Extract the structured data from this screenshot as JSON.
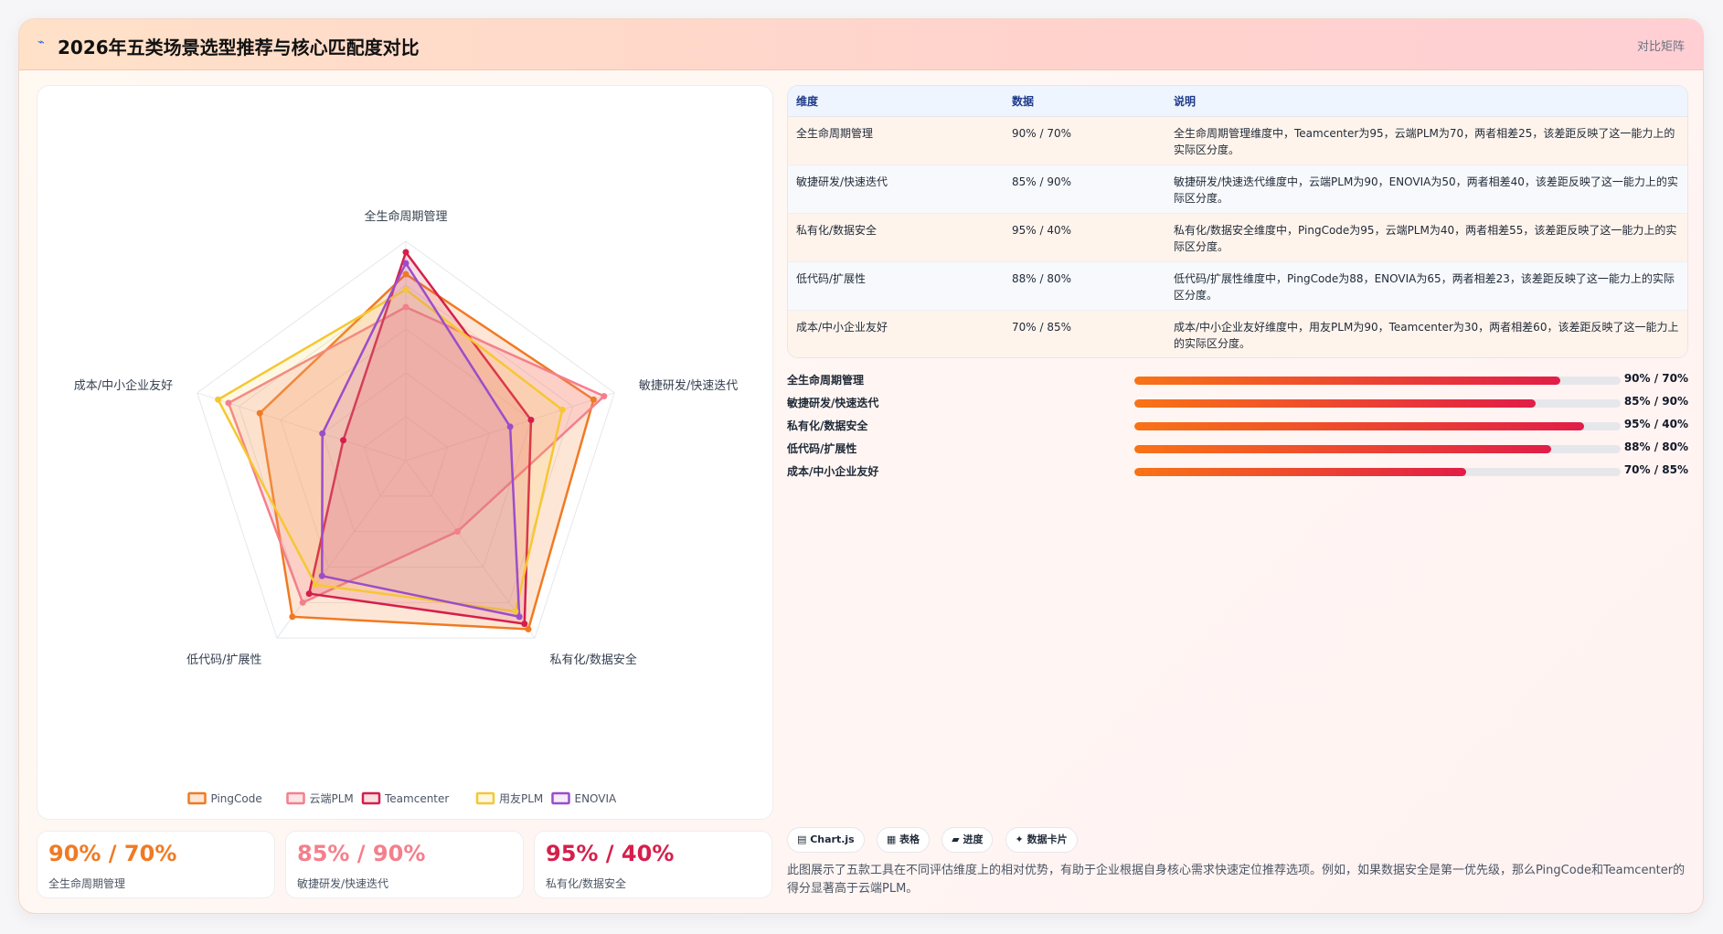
{
  "header": {
    "icon": "chart-icon",
    "title": "2026年五类场景选型推荐与核心匹配度对比",
    "tag": "对比矩阵"
  },
  "chart_data": {
    "type": "radar",
    "axes": [
      "全生命周期管理",
      "敏捷研发/快速迭代",
      "私有化/数据安全",
      "低代码/扩展性",
      "成本/中小企业友好"
    ],
    "rmax": 100,
    "rings": 5,
    "series": [
      {
        "name": "PingCode",
        "color": "#f07a23",
        "fill": "rgba(249,140,70,0.22)",
        "values": [
          85,
          90,
          95,
          88,
          70
        ]
      },
      {
        "name": "云端PLM",
        "color": "#f47f8c",
        "fill": "rgba(247,130,140,0.22)",
        "values": [
          70,
          95,
          40,
          80,
          85
        ]
      },
      {
        "name": "Teamcenter",
        "color": "#d51f4b",
        "fill": "rgba(220,70,90,0.18)",
        "values": [
          95,
          60,
          92,
          75,
          30
        ]
      },
      {
        "name": "用友PLM",
        "color": "#f5c733",
        "fill": "rgba(250,210,70,0.15)",
        "values": [
          78,
          75,
          85,
          70,
          90
        ]
      },
      {
        "name": "ENOVIA",
        "color": "#9b4dca",
        "fill": "rgba(170,100,210,0.12)",
        "values": [
          90,
          50,
          88,
          65,
          40
        ]
      }
    ]
  },
  "kpis": [
    {
      "value": "90% / 70%",
      "label": "全生命周期管理",
      "color": "#f07a23"
    },
    {
      "value": "85% / 90%",
      "label": "敏捷研发/快速迭代",
      "color": "#f47f8c"
    },
    {
      "value": "95% / 40%",
      "label": "私有化/数据安全",
      "color": "#d51f4b"
    }
  ],
  "table": {
    "headers": [
      "维度",
      "数据",
      "说明"
    ],
    "rows": [
      [
        "全生命周期管理",
        "90% / 70%",
        "全生命周期管理维度中，Teamcenter为95，云端PLM为70，两者相差25，该差距反映了这一能力上的实际区分度。"
      ],
      [
        "敏捷研发/快速迭代",
        "85% / 90%",
        "敏捷研发/快速迭代维度中，云端PLM为90，ENOVIA为50，两者相差40，该差距反映了这一能力上的实际区分度。"
      ],
      [
        "私有化/数据安全",
        "95% / 40%",
        "私有化/数据安全维度中，PingCode为95，云端PLM为40，两者相差55，该差距反映了这一能力上的实际区分度。"
      ],
      [
        "低代码/扩展性",
        "88% / 80%",
        "低代码/扩展性维度中，PingCode为88，ENOVIA为65，两者相差23，该差距反映了这一能力上的实际区分度。"
      ],
      [
        "成本/中小企业友好",
        "70% / 85%",
        "成本/中小企业友好维度中，用友PLM为90，Teamcenter为30，两者相差60，该差距反映了这一能力上的实际区分度。"
      ]
    ]
  },
  "bars": [
    {
      "label": "全生命周期管理",
      "value": "90% / 70%",
      "fill": 0.875
    },
    {
      "label": "敏捷研发/快速迭代",
      "value": "85% / 90%",
      "fill": 0.826
    },
    {
      "label": "私有化/数据安全",
      "value": "95% / 40%",
      "fill": 0.925
    },
    {
      "label": "低代码/扩展性",
      "value": "88% / 80%",
      "fill": 0.857
    },
    {
      "label": "成本/中小企业友好",
      "value": "70% / 85%",
      "fill": 0.682
    }
  ],
  "chips": [
    "▤ Chart.js",
    "▦ 表格",
    "▰ 进度",
    "✦ 数据卡片"
  ],
  "description": "此图展示了五款工具在不同评估维度上的相对优势，有助于企业根据自身核心需求快速定位推荐选项。例如，如果数据安全是第一优先级，那么PingCode和Teamcenter的得分显著高于云端PLM。"
}
